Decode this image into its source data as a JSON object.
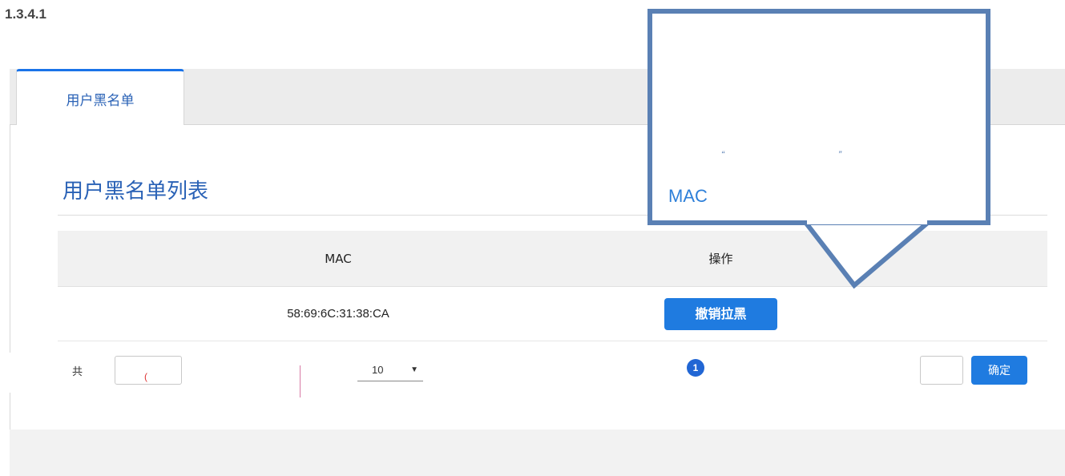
{
  "section_number": "1.3.4.1",
  "tabs": [
    {
      "label": "用户黑名单",
      "active": true
    }
  ],
  "list": {
    "title": "用户黑名单列表",
    "columns": [
      "MAC",
      "操作"
    ],
    "rows": [
      {
        "mac": "58:69:6C:31:38:CA",
        "action_label": "撤销拉黑"
      }
    ]
  },
  "pager": {
    "total_prefix": "共",
    "page_size": "10",
    "current_page": "1",
    "go_label": "确定"
  },
  "callout": {
    "quote_open": "“",
    "quote_close": "”",
    "text": "MAC"
  },
  "colors": {
    "accent": "#1f7be0",
    "title_blue": "#2a62b6",
    "callout_border": "#5a80b4"
  }
}
